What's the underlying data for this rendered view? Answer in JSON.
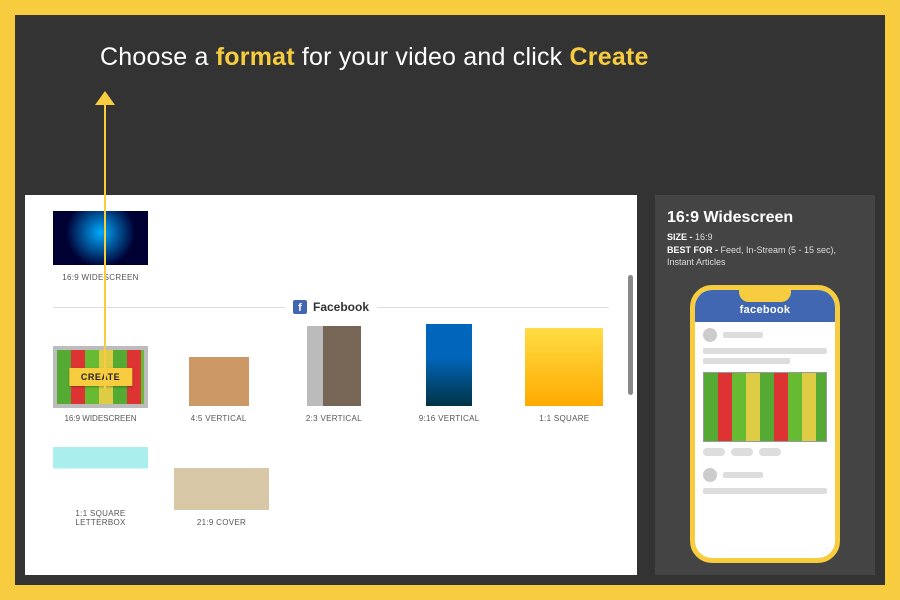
{
  "heading": {
    "pre": "Choose a ",
    "accent1": "format",
    "mid": " for your video and click ",
    "accent2": "Create"
  },
  "topThumb": {
    "label": "16:9 WIDESCREEN"
  },
  "section": {
    "platform": "Facebook"
  },
  "selected": {
    "label": "16:9 WIDESCREEN",
    "button": "CREATE"
  },
  "formats": {
    "f1": "4:5 VERTICAL",
    "f2": "2:3 VERTICAL",
    "f3": "9:16 VERTICAL",
    "f4": "1:1 SQUARE",
    "f5": "1:1 SQUARE LETTERBOX",
    "f6": "21:9 COVER"
  },
  "info": {
    "title": "16:9 Widescreen",
    "sizeKey": "SIZE -",
    "sizeVal": "  16:9",
    "bestKey": "BEST FOR -",
    "bestVal": "  Feed, In-Stream (5 - 15 sec), Instant Articles"
  },
  "phone": {
    "header": "facebook"
  }
}
